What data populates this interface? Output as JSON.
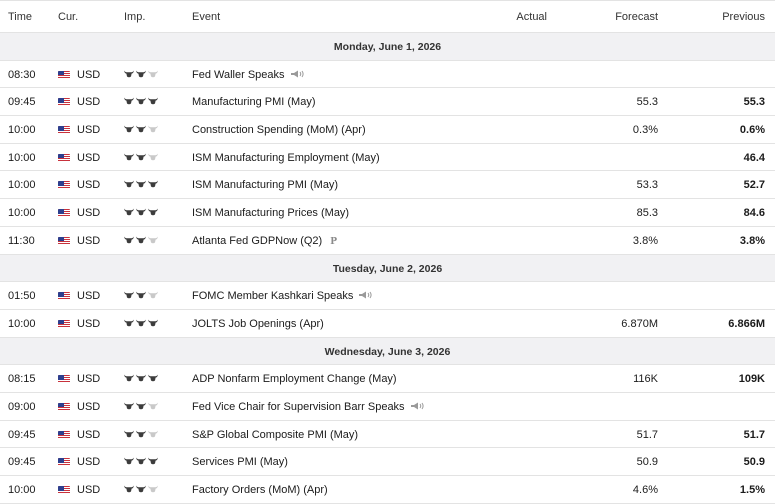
{
  "columns": {
    "time": "Time",
    "currency": "Cur.",
    "importance": "Imp.",
    "event": "Event",
    "actual": "Actual",
    "forecast": "Forecast",
    "previous": "Previous"
  },
  "colors": {
    "bull_filled": "#3c3c3c",
    "bull_empty": "#c9c9c9",
    "day_row_bg": "#f1f1f3",
    "border": "#e3e3e3"
  },
  "days": [
    {
      "label": "Monday, June 1, 2026",
      "events": [
        {
          "time": "08:30",
          "currency": "USD",
          "importance": 2,
          "event": "Fed Waller Speaks",
          "icon": "speaker-icon",
          "actual": "",
          "forecast": "",
          "previous": ""
        },
        {
          "time": "09:45",
          "currency": "USD",
          "importance": 3,
          "event": "Manufacturing PMI (May)",
          "icon": "",
          "actual": "",
          "forecast": "55.3",
          "previous": "55.3"
        },
        {
          "time": "10:00",
          "currency": "USD",
          "importance": 2,
          "event": "Construction Spending (MoM) (Apr)",
          "icon": "",
          "actual": "",
          "forecast": "0.3%",
          "previous": "0.6%"
        },
        {
          "time": "10:00",
          "currency": "USD",
          "importance": 2,
          "event": "ISM Manufacturing Employment (May)",
          "icon": "",
          "actual": "",
          "forecast": "",
          "previous": "46.4"
        },
        {
          "time": "10:00",
          "currency": "USD",
          "importance": 3,
          "event": "ISM Manufacturing PMI (May)",
          "icon": "",
          "actual": "",
          "forecast": "53.3",
          "previous": "52.7"
        },
        {
          "time": "10:00",
          "currency": "USD",
          "importance": 3,
          "event": "ISM Manufacturing Prices (May)",
          "icon": "",
          "actual": "",
          "forecast": "85.3",
          "previous": "84.6"
        },
        {
          "time": "11:30",
          "currency": "USD",
          "importance": 2,
          "event": "Atlanta Fed GDPNow (Q2)",
          "icon": "preliminary-icon",
          "actual": "",
          "forecast": "3.8%",
          "previous": "3.8%"
        }
      ]
    },
    {
      "label": "Tuesday, June 2, 2026",
      "events": [
        {
          "time": "01:50",
          "currency": "USD",
          "importance": 2,
          "event": "FOMC Member Kashkari Speaks",
          "icon": "speaker-icon",
          "actual": "",
          "forecast": "",
          "previous": ""
        },
        {
          "time": "10:00",
          "currency": "USD",
          "importance": 3,
          "event": "JOLTS Job Openings (Apr)",
          "icon": "",
          "actual": "",
          "forecast": "6.870M",
          "previous": "6.866M"
        }
      ]
    },
    {
      "label": "Wednesday, June 3, 2026",
      "events": [
        {
          "time": "08:15",
          "currency": "USD",
          "importance": 3,
          "event": "ADP Nonfarm Employment Change (May)",
          "icon": "",
          "actual": "",
          "forecast": "116K",
          "previous": "109K"
        },
        {
          "time": "09:00",
          "currency": "USD",
          "importance": 2,
          "event": "Fed Vice Chair for Supervision Barr Speaks",
          "icon": "speaker-icon",
          "actual": "",
          "forecast": "",
          "previous": ""
        },
        {
          "time": "09:45",
          "currency": "USD",
          "importance": 2,
          "event": "S&P Global Composite PMI (May)",
          "icon": "",
          "actual": "",
          "forecast": "51.7",
          "previous": "51.7"
        },
        {
          "time": "09:45",
          "currency": "USD",
          "importance": 3,
          "event": "Services PMI (May)",
          "icon": "",
          "actual": "",
          "forecast": "50.9",
          "previous": "50.9"
        },
        {
          "time": "10:00",
          "currency": "USD",
          "importance": 2,
          "event": "Factory Orders (MoM) (Apr)",
          "icon": "",
          "actual": "",
          "forecast": "4.6%",
          "previous": "1.5%"
        }
      ]
    }
  ]
}
